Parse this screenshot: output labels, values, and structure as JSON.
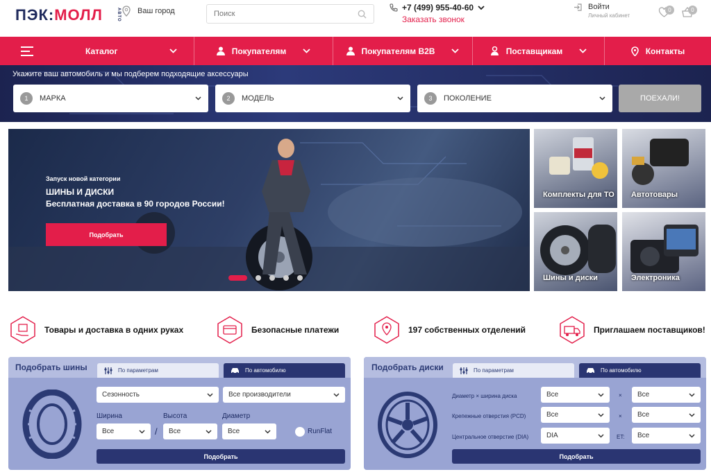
{
  "header": {
    "logo_main": "ПЭК:",
    "logo_accent": "МОЛЛ",
    "logo_small": "АВТО",
    "city_label": "Ваш город",
    "search_placeholder": "Поиск",
    "phone": "+7 (499) 955-40-60",
    "callback": "Заказать звонок",
    "login_label": "Войти",
    "login_sub": "Личный кабинет",
    "favorites_count": "0",
    "cart_count": "0"
  },
  "nav": {
    "catalog": "Каталог",
    "buyers": "Покупателям",
    "buyers_b2b": "Покупателям B2B",
    "suppliers": "Поставщикам",
    "contacts": "Контакты"
  },
  "selector": {
    "title": "Укажите ваш автомобиль и мы подберем подходящие аксессуары",
    "fields": [
      {
        "num": "1",
        "label": "МАРКА"
      },
      {
        "num": "2",
        "label": "МОДЕЛЬ"
      },
      {
        "num": "3",
        "label": "ПОКОЛЕНИЕ"
      }
    ],
    "go_label": "ПОЕХАЛИ!"
  },
  "hero": {
    "kicker": "Запуск новой категории",
    "title1": "ШИНЫ И ДИСКИ",
    "title2": "Бесплатная доставка в 90 городов России!",
    "button": "Подобрать"
  },
  "tiles": [
    {
      "label": "Комплекты для ТО"
    },
    {
      "label": "Автотовары"
    },
    {
      "label": "Шины и диски"
    },
    {
      "label": "Электроника"
    }
  ],
  "features": [
    {
      "icon": "box-hand-icon",
      "label": "Товары и доставка в одних руках"
    },
    {
      "icon": "card-icon",
      "label": "Безопасные платежи"
    },
    {
      "icon": "map-pin-icon",
      "label": "197 собственных отделений"
    },
    {
      "icon": "truck-icon",
      "label": "Приглашаем поставщиков!"
    }
  ],
  "tires": {
    "title": "Подобрать шины",
    "tab_params": "По параметрам",
    "tab_car": "По автомобилю",
    "season": "Сезонность",
    "maker": "Все производители",
    "width_label": "Ширина",
    "height_label": "Высота",
    "diameter_label": "Диаметр",
    "width_value": "Все",
    "height_value": "Все",
    "diameter_value": "Все",
    "slash": "/",
    "runflat": "RunFlat",
    "button": "Подобрать"
  },
  "disks": {
    "title": "Подобрать диски",
    "tab_params": "По параметрам",
    "tab_car": "По автомобилю",
    "row1_label": "Диаметр × ширина диска",
    "row2_label": "Крепежные отверстия (PCD)",
    "row3_label": "Центральное отверстие (DIA)",
    "row1_a": "Все",
    "row1_b": "Все",
    "row2_a": "Все",
    "row2_b": "Все",
    "row3_a": "DIA",
    "row3_b": "Все",
    "times": "×",
    "et_label": "ET:",
    "button": "Подобрать"
  },
  "colors": {
    "accent": "#e31e4a",
    "navy": "#2a3572",
    "panel": "#99a4d3"
  }
}
